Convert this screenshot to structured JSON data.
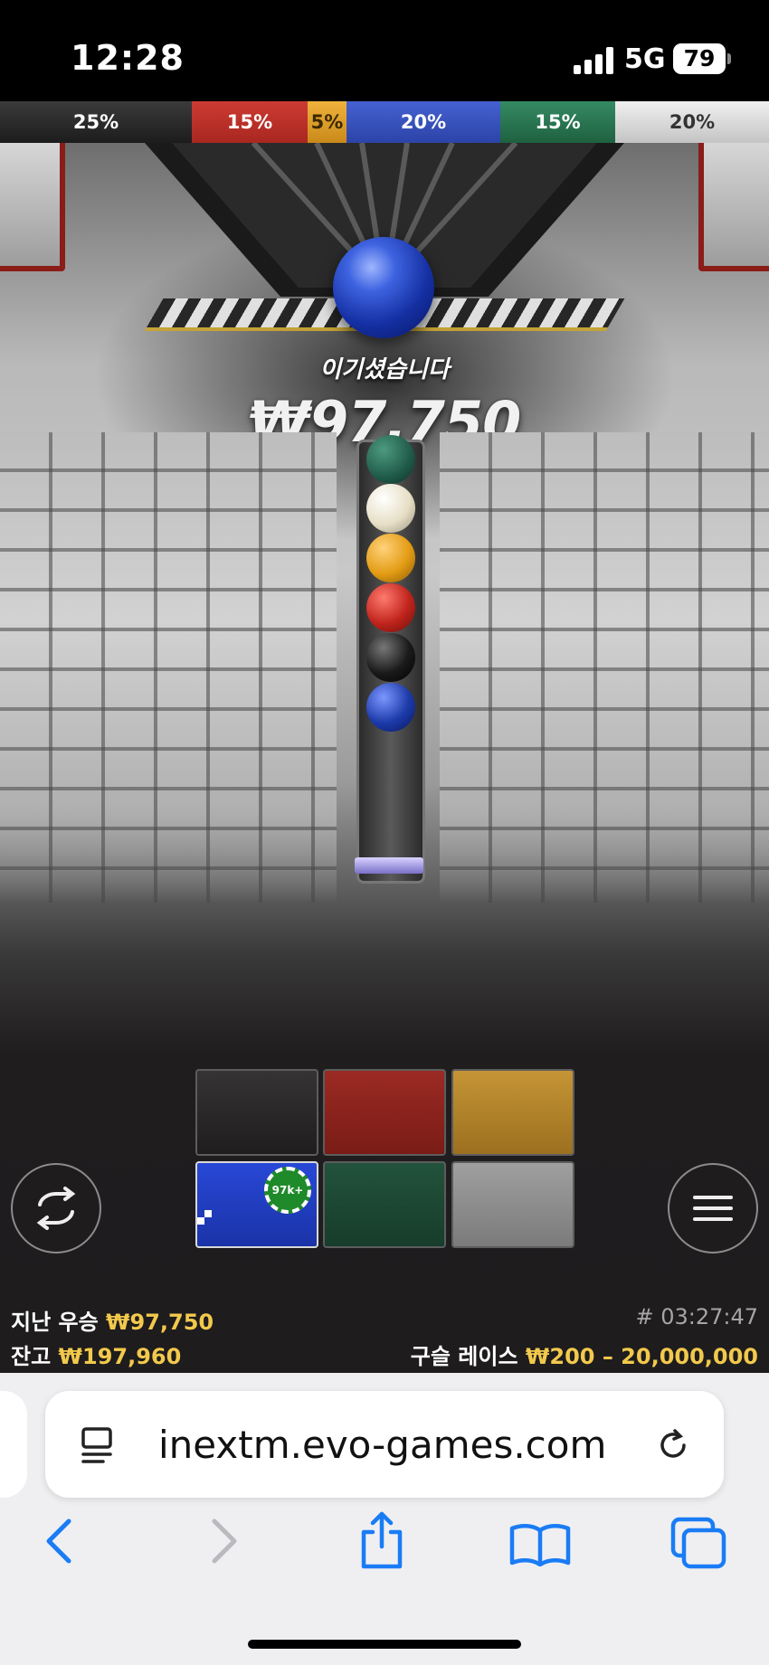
{
  "status_bar": {
    "time": "12:28",
    "network": "5G",
    "battery": "79"
  },
  "odds": [
    {
      "label": "25%",
      "color": "#2c2c2c"
    },
    {
      "label": "15%",
      "color": "#b8302a"
    },
    {
      "label": "5%",
      "color": "#d99a2b"
    },
    {
      "label": "20%",
      "color": "#3551c0"
    },
    {
      "label": "15%",
      "color": "#2b7a55"
    },
    {
      "label": "20%",
      "color": "#d9d9d9"
    }
  ],
  "game": {
    "win_label": "이기셨습니다",
    "win_amount": "₩97,750",
    "winning_ball_color": "#1a35b0",
    "tube_balls": [
      "#1f5a48",
      "#efe8d3",
      "#e39c14",
      "#c0241c",
      "#1a1a1a",
      "#1c3aa8"
    ]
  },
  "bets": [
    {
      "name": "bet-black",
      "color": "#2a2829"
    },
    {
      "name": "bet-red",
      "color": "#8f241e"
    },
    {
      "name": "bet-gold",
      "color": "#b48628"
    },
    {
      "name": "bet-blue",
      "color": "#1f3fc4"
    },
    {
      "name": "bet-green",
      "color": "#1d4a35"
    },
    {
      "name": "bet-silver",
      "color": "#8f8f8f"
    }
  ],
  "chip": {
    "label": "97k+"
  },
  "footer": {
    "last_win_label": "지난 우승",
    "last_win_value": "₩97,750",
    "balance_label": "잔고",
    "balance_value": "₩197,960",
    "round_id": "# 03:27:47",
    "game_label": "구슬 레이스",
    "bet_range": "₩200 – 20,000,000"
  },
  "browser": {
    "url": "inextm.evo-games.com"
  }
}
